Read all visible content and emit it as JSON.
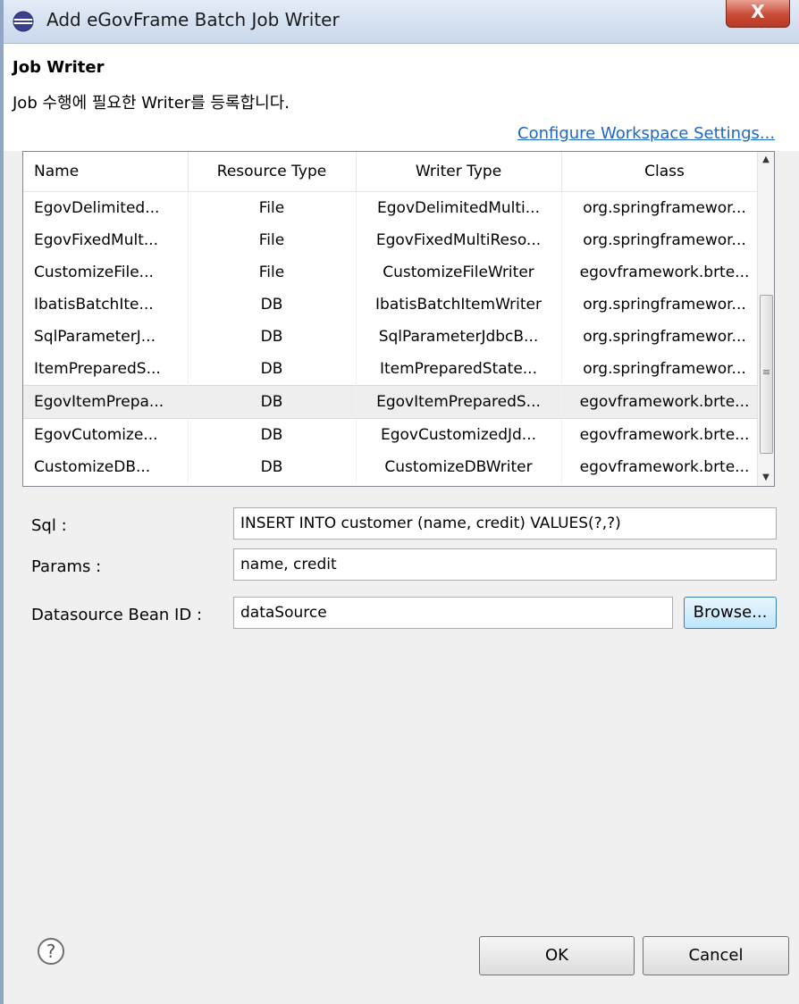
{
  "window": {
    "title": "Add eGovFrame Batch Job Writer",
    "close_label": "X"
  },
  "header": {
    "title": "Job Writer",
    "description": "Job 수행에 필요한 Writer를 등록합니다.",
    "configure_link": "Configure Workspace Settings..."
  },
  "table": {
    "columns": [
      "Name",
      "Resource Type",
      "Writer Type",
      "Class"
    ],
    "rows": [
      [
        "EgovDelimited...",
        "File",
        "EgovDelimitedMulti...",
        "org.springframewor..."
      ],
      [
        "EgovFixedMult...",
        "File",
        "EgovFixedMultiReso...",
        "org.springframewor..."
      ],
      [
        "CustomizeFile...",
        "File",
        "CustomizeFileWriter",
        "egovframework.brte..."
      ],
      [
        "IbatisBatchIte...",
        "DB",
        "IbatisBatchItemWriter",
        "org.springframewor..."
      ],
      [
        "SqlParameterJ...",
        "DB",
        "SqlParameterJdbcB...",
        "org.springframewor..."
      ],
      [
        "ItemPreparedS...",
        "DB",
        "ItemPreparedState...",
        "org.springframewor..."
      ],
      [
        "EgovItemPrepa...",
        "DB",
        "EgovItemPreparedS...",
        "egovframework.brte..."
      ],
      [
        "EgovCutomize...",
        "DB",
        "EgovCustomizedJd...",
        "egovframework.brte..."
      ],
      [
        "CustomizeDB...",
        "DB",
        "CustomizeDBWriter",
        "egovframework.brte..."
      ]
    ],
    "selected_row": 6
  },
  "form": {
    "sql_label": "Sql :",
    "sql_value": "INSERT INTO customer (name, credit) VALUES(?,?)",
    "params_label": "Params :",
    "params_value": "name, credit",
    "datasource_label": "Datasource Bean ID :",
    "datasource_value": "dataSource",
    "browse_label": "Browse..."
  },
  "footer": {
    "help_symbol": "?",
    "ok_label": "OK",
    "cancel_label": "Cancel"
  },
  "colors": {
    "link": "#1a67c8",
    "close_button": "#c84b36",
    "selected_row": "#eeeeee"
  }
}
